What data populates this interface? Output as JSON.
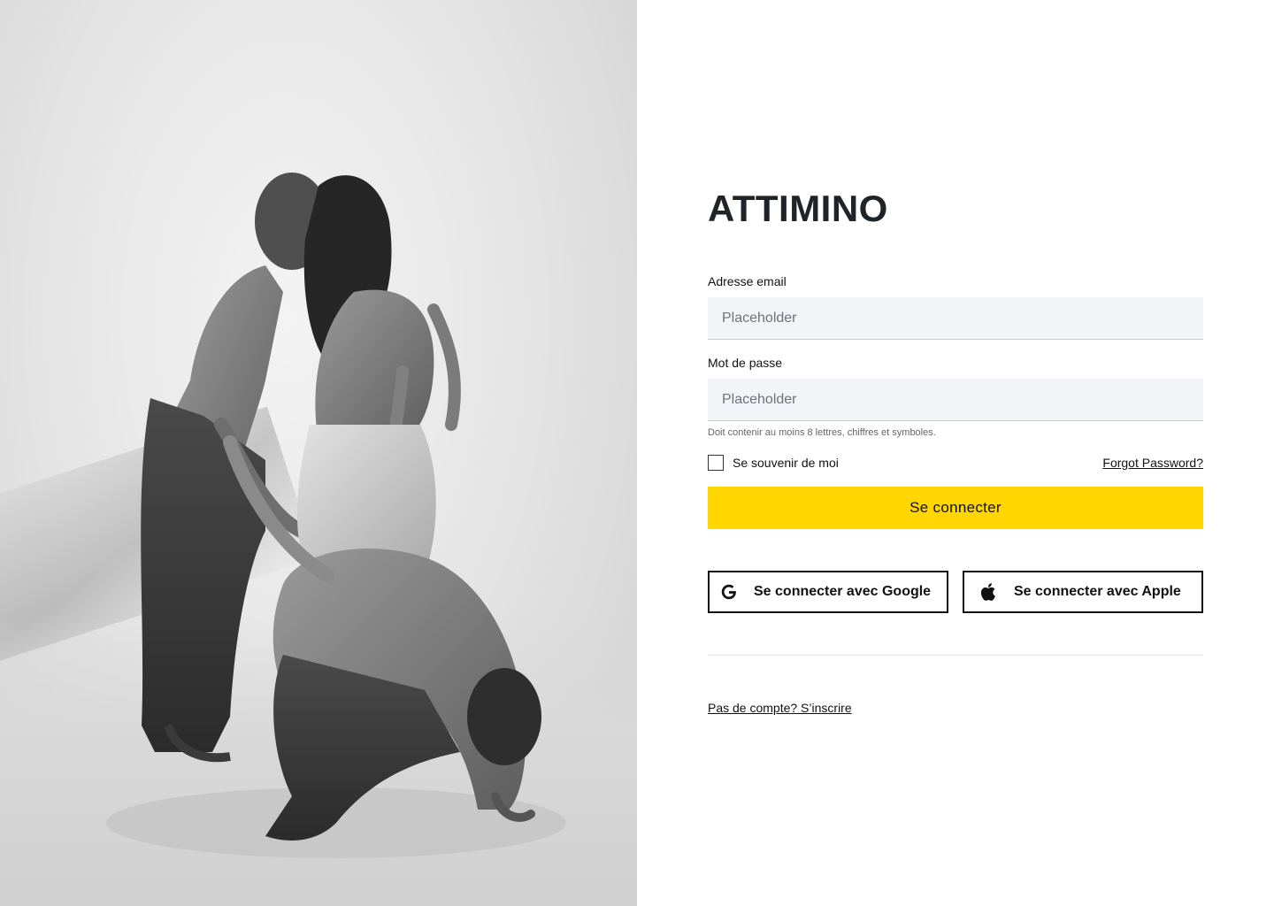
{
  "photo": {
    "alt": ""
  },
  "brand": {
    "name": "ATTIMINO"
  },
  "form": {
    "email": {
      "label": "Adresse email",
      "placeholder": "Placeholder",
      "value": ""
    },
    "password": {
      "label": "Mot de passe",
      "placeholder": "Placeholder",
      "value": "",
      "helper": "Doit contenir au moins 8 lettres, chiffres et symboles."
    },
    "remember_label": "Se souvenir de moi",
    "remember_checked": false,
    "forgot_label": "Forgot Password?",
    "submit_label": "Se connecter",
    "submit_color": "#FFD600"
  },
  "social": {
    "google_label": "Se connecter avec Google",
    "google_icon": "google-icon",
    "apple_label": "Se connecter avec Apple",
    "apple_icon": "apple-icon"
  },
  "footer": {
    "signup_label": "Pas de compte? S’inscrire"
  }
}
